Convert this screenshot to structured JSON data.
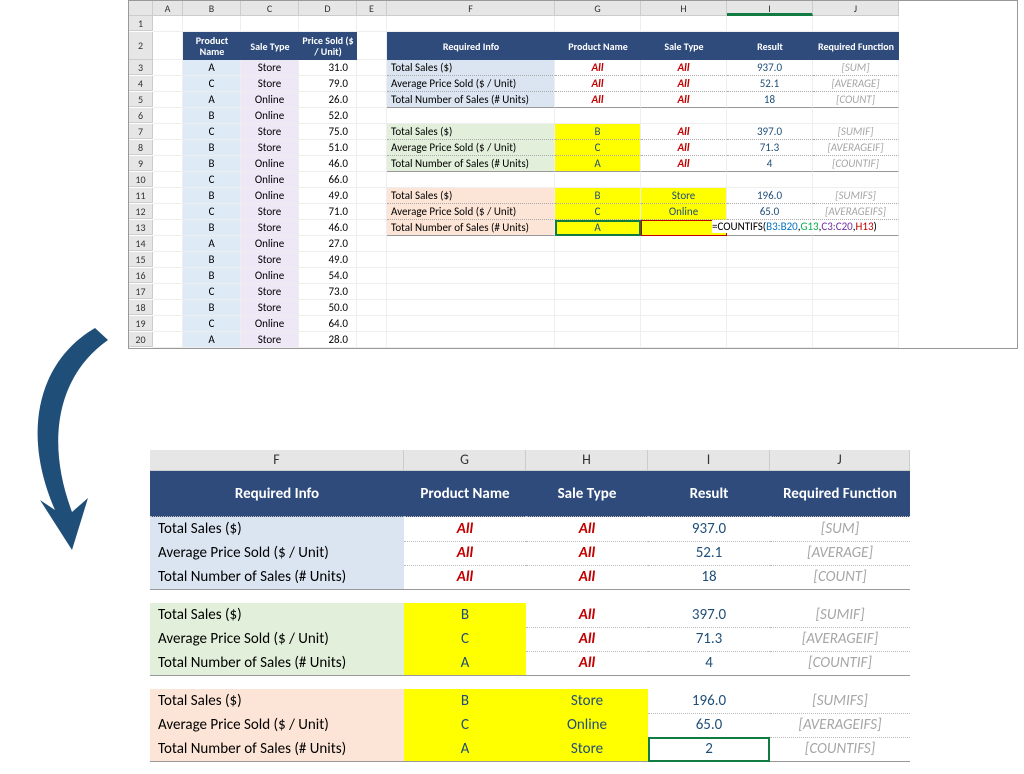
{
  "top": {
    "columns": [
      "",
      "A",
      "B",
      "C",
      "D",
      "E",
      "F",
      "G",
      "H",
      "I",
      "J"
    ],
    "headers1": {
      "b": "Product Name",
      "c": "Sale Type",
      "d": "Price Sold ($ / Unit)"
    },
    "headers2": {
      "f": "Required Info",
      "g": "Product Name",
      "h": "Sale Type",
      "i": "Result",
      "j": "Required Function"
    },
    "data_rows": [
      {
        "n": "3",
        "b": "A",
        "c": "Store",
        "d": "31.0"
      },
      {
        "n": "4",
        "b": "C",
        "c": "Store",
        "d": "79.0"
      },
      {
        "n": "5",
        "b": "A",
        "c": "Online",
        "d": "26.0"
      },
      {
        "n": "6",
        "b": "B",
        "c": "Online",
        "d": "52.0"
      },
      {
        "n": "7",
        "b": "C",
        "c": "Store",
        "d": "75.0"
      },
      {
        "n": "8",
        "b": "B",
        "c": "Store",
        "d": "51.0"
      },
      {
        "n": "9",
        "b": "B",
        "c": "Online",
        "d": "46.0"
      },
      {
        "n": "10",
        "b": "C",
        "c": "Online",
        "d": "66.0"
      },
      {
        "n": "11",
        "b": "B",
        "c": "Online",
        "d": "49.0"
      },
      {
        "n": "12",
        "b": "C",
        "c": "Store",
        "d": "71.0"
      },
      {
        "n": "13",
        "b": "B",
        "c": "Store",
        "d": "46.0"
      },
      {
        "n": "14",
        "b": "A",
        "c": "Online",
        "d": "27.0"
      },
      {
        "n": "15",
        "b": "B",
        "c": "Store",
        "d": "49.0"
      },
      {
        "n": "16",
        "b": "B",
        "c": "Online",
        "d": "54.0"
      },
      {
        "n": "17",
        "b": "C",
        "c": "Store",
        "d": "73.0"
      },
      {
        "n": "18",
        "b": "B",
        "c": "Store",
        "d": "50.0"
      },
      {
        "n": "19",
        "b": "C",
        "c": "Online",
        "d": "64.0"
      },
      {
        "n": "20",
        "b": "A",
        "c": "Store",
        "d": "28.0"
      }
    ],
    "block1": [
      {
        "f": "Total Sales ($)",
        "g": "All",
        "h": "All",
        "i": "937.0",
        "j": "[SUM]"
      },
      {
        "f": "Average Price Sold ($ / Unit)",
        "g": "All",
        "h": "All",
        "i": "52.1",
        "j": "[AVERAGE]"
      },
      {
        "f": "Total Number of Sales (# Units)",
        "g": "All",
        "h": "All",
        "i": "18",
        "j": "[COUNT]"
      }
    ],
    "block2": [
      {
        "f": "Total Sales ($)",
        "g": "B",
        "h": "All",
        "i": "397.0",
        "j": "[SUMIF]"
      },
      {
        "f": "Average Price Sold ($ / Unit)",
        "g": "C",
        "h": "All",
        "i": "71.3",
        "j": "[AVERAGEIF]"
      },
      {
        "f": "Total Number of Sales (# Units)",
        "g": "A",
        "h": "All",
        "i": "4",
        "j": "[COUNTIF]"
      }
    ],
    "block3": [
      {
        "f": "Total Sales ($)",
        "g": "B",
        "h": "Store",
        "i": "196.0",
        "j": "[SUMIFS]"
      },
      {
        "f": "Average Price Sold ($ / Unit)",
        "g": "C",
        "h": "Online",
        "i": "65.0",
        "j": "[AVERAGEIFS]"
      },
      {
        "f": "Total Number of Sales (# Units)",
        "g": "A",
        "h": "",
        "i": "",
        "j": ""
      }
    ],
    "formula": {
      "eq": "=",
      "fn": "COUNTIFS(",
      "a1": "B3:B20",
      "c1": ",",
      "a2": "G13",
      "c2": ",",
      "a3": "C3:C20",
      "c3": ",",
      "a4": "H13",
      "close": ")"
    }
  },
  "bottom": {
    "columns": [
      "F",
      "G",
      "H",
      "I",
      "J"
    ],
    "headers": {
      "f": "Required Info",
      "g": "Product Name",
      "h": "Sale Type",
      "i": "Result",
      "j": "Required Function"
    },
    "block1": [
      {
        "f": "Total Sales ($)",
        "g": "All",
        "h": "All",
        "i": "937.0",
        "j": "[SUM]"
      },
      {
        "f": "Average Price Sold ($ / Unit)",
        "g": "All",
        "h": "All",
        "i": "52.1",
        "j": "[AVERAGE]"
      },
      {
        "f": "Total Number of Sales (# Units)",
        "g": "All",
        "h": "All",
        "i": "18",
        "j": "[COUNT]"
      }
    ],
    "block2": [
      {
        "f": "Total Sales ($)",
        "g": "B",
        "h": "All",
        "i": "397.0",
        "j": "[SUMIF]"
      },
      {
        "f": "Average Price Sold ($ / Unit)",
        "g": "C",
        "h": "All",
        "i": "71.3",
        "j": "[AVERAGEIF]"
      },
      {
        "f": "Total Number of Sales (# Units)",
        "g": "A",
        "h": "All",
        "i": "4",
        "j": "[COUNTIF]"
      }
    ],
    "block3": [
      {
        "f": "Total Sales ($)",
        "g": "B",
        "h": "Store",
        "i": "196.0",
        "j": "[SUMIFS]"
      },
      {
        "f": "Average Price Sold ($ / Unit)",
        "g": "C",
        "h": "Online",
        "i": "65.0",
        "j": "[AVERAGEIFS]"
      },
      {
        "f": "Total Number of Sales (# Units)",
        "g": "A",
        "h": "Store",
        "i": "2",
        "j": "[COUNTIFS]"
      }
    ]
  },
  "chart_data": {
    "type": "table",
    "title": "Excel conditional aggregate functions example",
    "raw_data": [
      {
        "product": "A",
        "sale_type": "Store",
        "price": 31.0
      },
      {
        "product": "C",
        "sale_type": "Store",
        "price": 79.0
      },
      {
        "product": "A",
        "sale_type": "Online",
        "price": 26.0
      },
      {
        "product": "B",
        "sale_type": "Online",
        "price": 52.0
      },
      {
        "product": "C",
        "sale_type": "Store",
        "price": 75.0
      },
      {
        "product": "B",
        "sale_type": "Store",
        "price": 51.0
      },
      {
        "product": "B",
        "sale_type": "Online",
        "price": 46.0
      },
      {
        "product": "C",
        "sale_type": "Online",
        "price": 66.0
      },
      {
        "product": "B",
        "sale_type": "Online",
        "price": 49.0
      },
      {
        "product": "C",
        "sale_type": "Store",
        "price": 71.0
      },
      {
        "product": "B",
        "sale_type": "Store",
        "price": 46.0
      },
      {
        "product": "A",
        "sale_type": "Online",
        "price": 27.0
      },
      {
        "product": "B",
        "sale_type": "Store",
        "price": 49.0
      },
      {
        "product": "B",
        "sale_type": "Online",
        "price": 54.0
      },
      {
        "product": "C",
        "sale_type": "Store",
        "price": 73.0
      },
      {
        "product": "B",
        "sale_type": "Store",
        "price": 50.0
      },
      {
        "product": "C",
        "sale_type": "Online",
        "price": 64.0
      },
      {
        "product": "A",
        "sale_type": "Store",
        "price": 28.0
      }
    ],
    "results": [
      {
        "metric": "Total Sales ($)",
        "product": "All",
        "sale_type": "All",
        "result": 937.0,
        "function": "SUM"
      },
      {
        "metric": "Average Price Sold ($ / Unit)",
        "product": "All",
        "sale_type": "All",
        "result": 52.1,
        "function": "AVERAGE"
      },
      {
        "metric": "Total Number of Sales (# Units)",
        "product": "All",
        "sale_type": "All",
        "result": 18,
        "function": "COUNT"
      },
      {
        "metric": "Total Sales ($)",
        "product": "B",
        "sale_type": "All",
        "result": 397.0,
        "function": "SUMIF"
      },
      {
        "metric": "Average Price Sold ($ / Unit)",
        "product": "C",
        "sale_type": "All",
        "result": 71.3,
        "function": "AVERAGEIF"
      },
      {
        "metric": "Total Number of Sales (# Units)",
        "product": "A",
        "sale_type": "All",
        "result": 4,
        "function": "COUNTIF"
      },
      {
        "metric": "Total Sales ($)",
        "product": "B",
        "sale_type": "Store",
        "result": 196.0,
        "function": "SUMIFS"
      },
      {
        "metric": "Average Price Sold ($ / Unit)",
        "product": "C",
        "sale_type": "Online",
        "result": 65.0,
        "function": "AVERAGEIFS"
      },
      {
        "metric": "Total Number of Sales (# Units)",
        "product": "A",
        "sale_type": "Store",
        "result": 2,
        "function": "COUNTIFS"
      }
    ]
  }
}
